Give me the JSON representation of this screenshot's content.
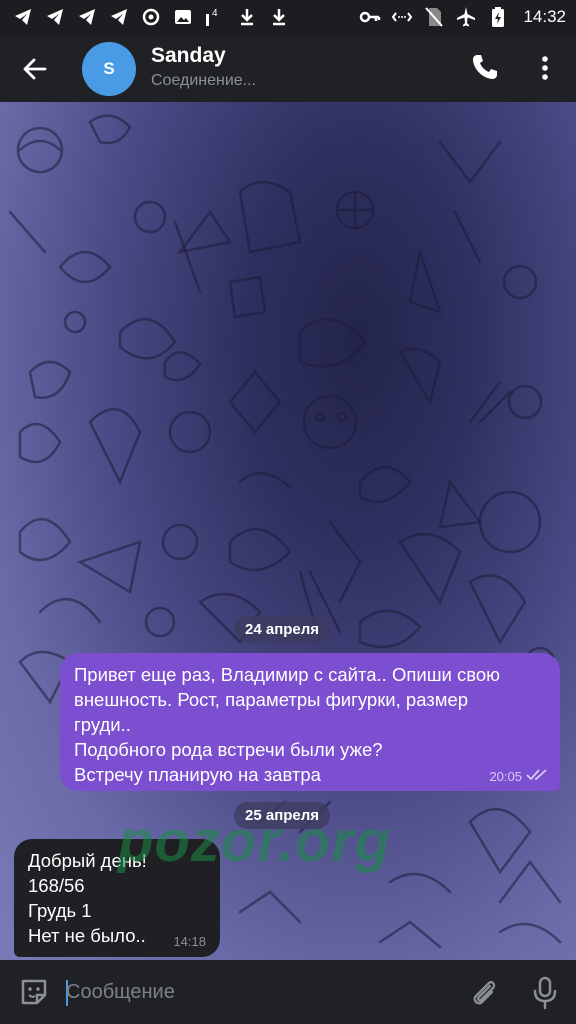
{
  "status_bar": {
    "time": "14:32",
    "left_icons": [
      "telegram-icon",
      "telegram-icon",
      "telegram-icon",
      "telegram-icon",
      "sync-icon",
      "image-icon",
      "signal-icon",
      "download-icon",
      "download-icon"
    ],
    "right_icons": [
      "key-icon",
      "data-transfer-icon",
      "no-sim-icon",
      "airplane-icon",
      "battery-charging-icon"
    ],
    "notification_badge": "4"
  },
  "header": {
    "avatar_letter": "S",
    "name": "Sanday",
    "status": "Соединение..."
  },
  "messages": [
    {
      "date": "24 апреля",
      "direction": "out",
      "lines": [
        "Привет еще раз, Владимир с сайта.. Опиши свою",
        "внешность. Рост, параметры фигурки, размер",
        "груди..",
        "Подобного рода встречи были уже?",
        "Встречу планирую на завтра"
      ],
      "time": "20:05",
      "read": true
    },
    {
      "date": "25 апреля",
      "direction": "in",
      "lines": [
        "Добрый день!",
        "168/56",
        "Грудь 1",
        "Нет не было.."
      ],
      "time": "14:18"
    }
  ],
  "watermark": "pozor.org",
  "input": {
    "placeholder": "Сообщение"
  },
  "colors": {
    "outgoing_bubble": "#7b4fd0",
    "incoming_bubble": "#1f1f24",
    "accent": "#4a9be5",
    "watermark": "#198c46"
  }
}
